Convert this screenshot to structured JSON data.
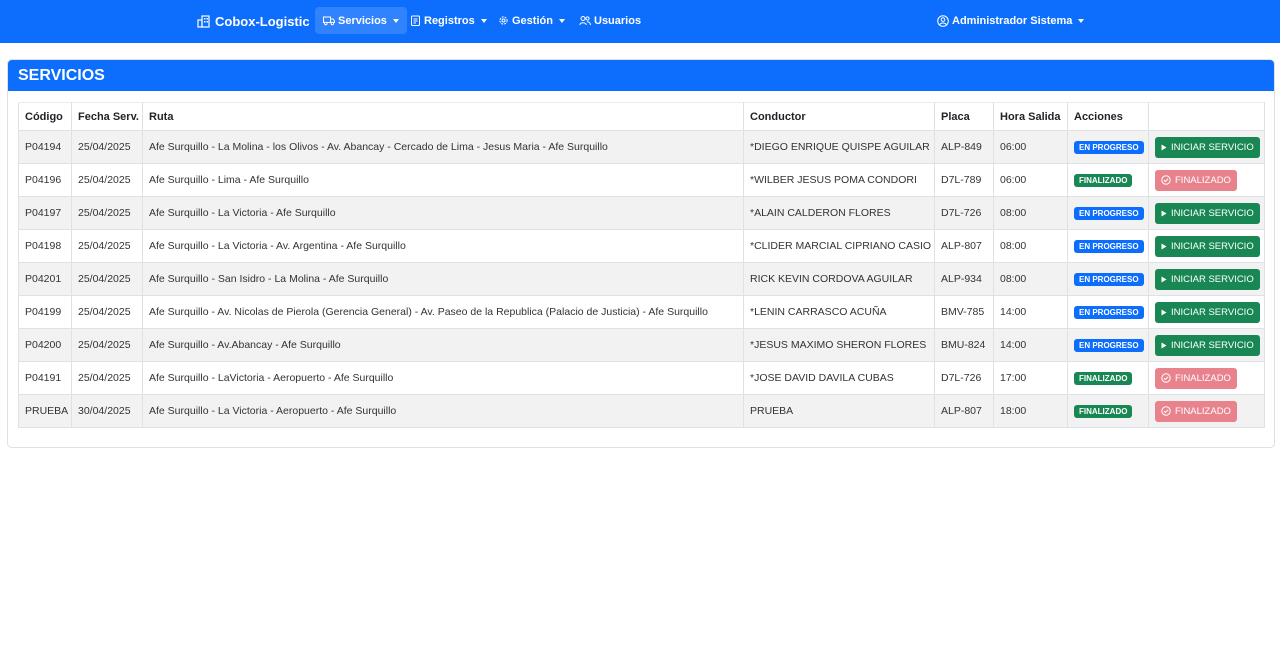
{
  "navbar": {
    "brand": "Cobox-Logistic",
    "items": [
      {
        "label": "Servicios",
        "active": true
      },
      {
        "label": "Registros"
      },
      {
        "label": "Gestión"
      },
      {
        "label": "Usuarios"
      }
    ],
    "user": "Administrador Sistema"
  },
  "card": {
    "title": "SERVICIOS"
  },
  "table": {
    "headers": [
      "Código",
      "Fecha Serv.",
      "Ruta",
      "Conductor",
      "Placa",
      "Hora Salida",
      "Acciones",
      ""
    ],
    "rows": [
      {
        "codigo": "P04194",
        "fecha": "25/04/2025",
        "ruta": "Afe Surquillo - La Molina - los Olivos - Av. Abancay - Cercado de Lima - Jesus Maria - Afe Surquillo",
        "conductor": "*DIEGO ENRIQUE QUISPE AGUILAR",
        "placa": "ALP-849",
        "hora": "06:00",
        "estado": "EN PROGRESO",
        "accion": "INICIAR SERVICIO"
      },
      {
        "codigo": "P04196",
        "fecha": "25/04/2025",
        "ruta": "Afe Surquillo - Lima - Afe Surquillo",
        "conductor": "*WILBER JESUS POMA CONDORI",
        "placa": "D7L-789",
        "hora": "06:00",
        "estado": "FINALIZADO",
        "accion": "FINALIZADO"
      },
      {
        "codigo": "P04197",
        "fecha": "25/04/2025",
        "ruta": "Afe Surquillo - La Victoria - Afe Surquillo",
        "conductor": "*ALAIN CALDERON FLORES",
        "placa": "D7L-726",
        "hora": "08:00",
        "estado": "EN PROGRESO",
        "accion": "INICIAR SERVICIO"
      },
      {
        "codigo": "P04198",
        "fecha": "25/04/2025",
        "ruta": "Afe Surquillo - La Victoria - Av. Argentina - Afe Surquillo",
        "conductor": "*CLIDER MARCIAL CIPRIANO CASIO",
        "placa": "ALP-807",
        "hora": "08:00",
        "estado": "EN PROGRESO",
        "accion": "INICIAR SERVICIO"
      },
      {
        "codigo": "P04201",
        "fecha": "25/04/2025",
        "ruta": "Afe Surquillo - San Isidro - La Molina - Afe Surquillo",
        "conductor": "RICK KEVIN CORDOVA AGUILAR",
        "placa": "ALP-934",
        "hora": "08:00",
        "estado": "EN PROGRESO",
        "accion": "INICIAR SERVICIO"
      },
      {
        "codigo": "P04199",
        "fecha": "25/04/2025",
        "ruta": "Afe Surquillo - Av. Nicolas de Pierola (Gerencia General) - Av. Paseo de la Republica (Palacio de Justicia) - Afe Surquillo",
        "conductor": "*LENIN CARRASCO ACUÑA",
        "placa": "BMV-785",
        "hora": "14:00",
        "estado": "EN PROGRESO",
        "accion": "INICIAR SERVICIO"
      },
      {
        "codigo": "P04200",
        "fecha": "25/04/2025",
        "ruta": "Afe Surquillo - Av.Abancay - Afe Surquillo",
        "conductor": "*JESUS MAXIMO SHERON FLORES",
        "placa": "BMU-824",
        "hora": "14:00",
        "estado": "EN PROGRESO",
        "accion": "INICIAR SERVICIO"
      },
      {
        "codigo": "P04191",
        "fecha": "25/04/2025",
        "ruta": "Afe Surquillo - LaVictoria - Aeropuerto - Afe Surquillo",
        "conductor": "*JOSE DAVID DAVILA CUBAS",
        "placa": "D7L-726",
        "hora": "17:00",
        "estado": "FINALIZADO",
        "accion": "FINALIZADO"
      },
      {
        "codigo": "PRUEBA",
        "fecha": "30/04/2025",
        "ruta": "Afe Surquillo - La Victoria - Aeropuerto - Afe Surquillo",
        "conductor": "PRUEBA",
        "placa": "ALP-807",
        "hora": "18:00",
        "estado": "FINALIZADO",
        "accion": "FINALIZADO"
      }
    ]
  },
  "colors": {
    "primary": "#0d6efd",
    "success": "#198754",
    "finalizado_button": "#e8838d"
  }
}
